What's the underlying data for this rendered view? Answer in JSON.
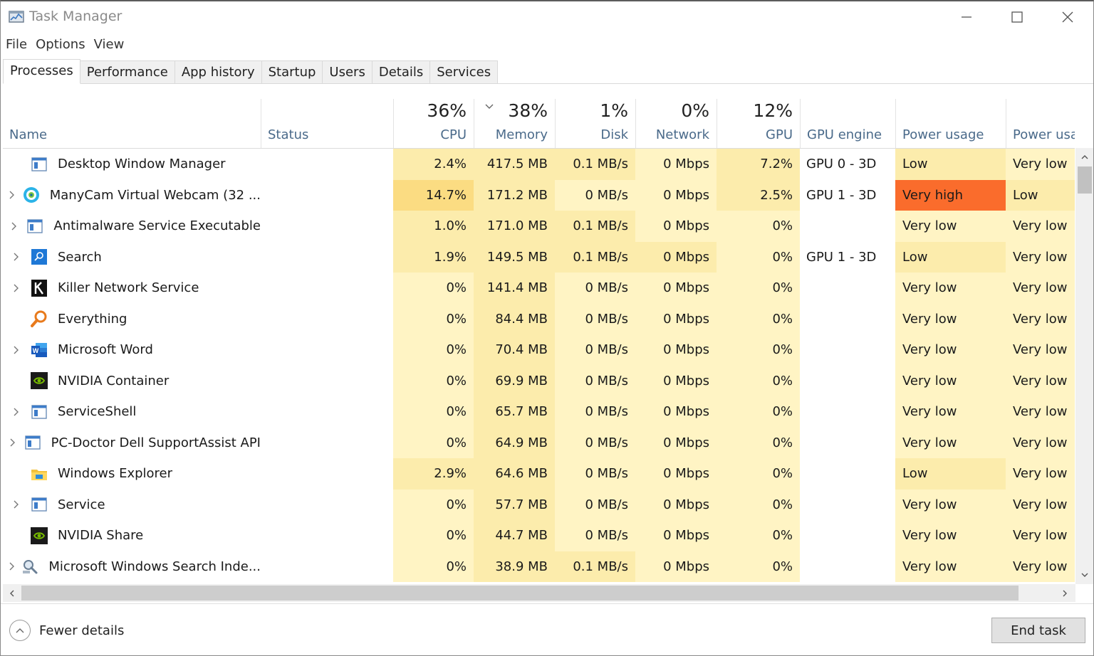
{
  "window": {
    "title": "Task Manager"
  },
  "menu": [
    "File",
    "Options",
    "View"
  ],
  "tabs": [
    {
      "label": "Processes",
      "active": true
    },
    {
      "label": "Performance",
      "active": false
    },
    {
      "label": "App history",
      "active": false
    },
    {
      "label": "Startup",
      "active": false
    },
    {
      "label": "Users",
      "active": false
    },
    {
      "label": "Details",
      "active": false
    },
    {
      "label": "Services",
      "active": false
    }
  ],
  "columns": {
    "name": {
      "label": "Name"
    },
    "status": {
      "label": "Status"
    },
    "cpu": {
      "label": "CPU",
      "pct": "36%"
    },
    "memory": {
      "label": "Memory",
      "pct": "38%"
    },
    "disk": {
      "label": "Disk",
      "pct": "1%"
    },
    "network": {
      "label": "Network",
      "pct": "0%"
    },
    "gpu": {
      "label": "GPU",
      "pct": "12%"
    },
    "gpu_engine": {
      "label": "GPU engine"
    },
    "power": {
      "label": "Power usage"
    },
    "power_trend": {
      "label": "Power usage"
    }
  },
  "colors": {
    "heat_light": "#fff4c4",
    "heat_mid": "#fcecac",
    "heat_strong": "#fbdc82",
    "very_high": "#fa6c2c",
    "header_label": "#4a6a8a"
  },
  "rows": [
    {
      "name": "Desktop Window Manager",
      "icon": "app-window-icon",
      "expand": false,
      "cpu": "2.4%",
      "mem": "417.5 MB",
      "disk": "0.1 MB/s",
      "net": "0 Mbps",
      "gpu": "7.2%",
      "engine": "GPU 0 - 3D",
      "power": "Low",
      "trend": "Very low",
      "heat": {
        "cpu": "mid",
        "mem": "mid",
        "disk": "mid",
        "net": "light",
        "gpu": "mid",
        "power": "mid",
        "trend": "light"
      }
    },
    {
      "name": "ManyCam Virtual Webcam (32 ...",
      "icon": "manycam-icon",
      "expand": true,
      "cpu": "14.7%",
      "mem": "171.2 MB",
      "disk": "0 MB/s",
      "net": "0 Mbps",
      "gpu": "2.5%",
      "engine": "GPU 1 - 3D",
      "power": "Very high",
      "trend": "Low",
      "heat": {
        "cpu": "strong",
        "mem": "mid",
        "disk": "light",
        "net": "light",
        "gpu": "mid",
        "power": "veryhigh",
        "trend": "mid"
      }
    },
    {
      "name": "Antimalware Service Executable",
      "icon": "app-window-icon",
      "expand": true,
      "cpu": "1.0%",
      "mem": "171.0 MB",
      "disk": "0.1 MB/s",
      "net": "0 Mbps",
      "gpu": "0%",
      "engine": "",
      "power": "Very low",
      "trend": "Very low",
      "heat": {
        "cpu": "mid",
        "mem": "mid",
        "disk": "mid",
        "net": "light",
        "gpu": "light",
        "power": "light",
        "trend": "light"
      }
    },
    {
      "name": "Search",
      "icon": "search-app-icon",
      "expand": true,
      "cpu": "1.9%",
      "mem": "149.5 MB",
      "disk": "0.1 MB/s",
      "net": "0 Mbps",
      "gpu": "0%",
      "engine": "GPU 1 - 3D",
      "power": "Low",
      "trend": "Very low",
      "heat": {
        "cpu": "mid",
        "mem": "mid",
        "disk": "mid",
        "net": "mid",
        "gpu": "light",
        "power": "mid",
        "trend": "light"
      }
    },
    {
      "name": "Killer Network Service",
      "icon": "killer-icon",
      "expand": true,
      "cpu": "0%",
      "mem": "141.4 MB",
      "disk": "0 MB/s",
      "net": "0 Mbps",
      "gpu": "0%",
      "engine": "",
      "power": "Very low",
      "trend": "Very low",
      "heat": {
        "cpu": "light",
        "mem": "mid",
        "disk": "light",
        "net": "light",
        "gpu": "light",
        "power": "light",
        "trend": "light"
      }
    },
    {
      "name": "Everything",
      "icon": "everything-search-icon",
      "expand": false,
      "cpu": "0%",
      "mem": "84.4 MB",
      "disk": "0 MB/s",
      "net": "0 Mbps",
      "gpu": "0%",
      "engine": "",
      "power": "Very low",
      "trend": "Very low",
      "heat": {
        "cpu": "light",
        "mem": "mid",
        "disk": "light",
        "net": "light",
        "gpu": "light",
        "power": "light",
        "trend": "light"
      }
    },
    {
      "name": "Microsoft Word",
      "icon": "word-icon",
      "expand": true,
      "cpu": "0%",
      "mem": "70.4 MB",
      "disk": "0 MB/s",
      "net": "0 Mbps",
      "gpu": "0%",
      "engine": "",
      "power": "Very low",
      "trend": "Very low",
      "heat": {
        "cpu": "light",
        "mem": "mid",
        "disk": "light",
        "net": "light",
        "gpu": "light",
        "power": "light",
        "trend": "light"
      }
    },
    {
      "name": "NVIDIA Container",
      "icon": "nvidia-icon",
      "expand": false,
      "cpu": "0%",
      "mem": "69.9 MB",
      "disk": "0 MB/s",
      "net": "0 Mbps",
      "gpu": "0%",
      "engine": "",
      "power": "Very low",
      "trend": "Very low",
      "heat": {
        "cpu": "light",
        "mem": "mid",
        "disk": "light",
        "net": "light",
        "gpu": "light",
        "power": "light",
        "trend": "light"
      }
    },
    {
      "name": "ServiceShell",
      "icon": "app-window-icon",
      "expand": true,
      "cpu": "0%",
      "mem": "65.7 MB",
      "disk": "0 MB/s",
      "net": "0 Mbps",
      "gpu": "0%",
      "engine": "",
      "power": "Very low",
      "trend": "Very low",
      "heat": {
        "cpu": "light",
        "mem": "mid",
        "disk": "light",
        "net": "light",
        "gpu": "light",
        "power": "light",
        "trend": "light"
      }
    },
    {
      "name": "PC-Doctor Dell SupportAssist API",
      "icon": "app-window-icon",
      "expand": true,
      "cpu": "0%",
      "mem": "64.9 MB",
      "disk": "0 MB/s",
      "net": "0 Mbps",
      "gpu": "0%",
      "engine": "",
      "power": "Very low",
      "trend": "Very low",
      "heat": {
        "cpu": "light",
        "mem": "mid",
        "disk": "light",
        "net": "light",
        "gpu": "light",
        "power": "light",
        "trend": "light"
      }
    },
    {
      "name": "Windows Explorer",
      "icon": "folder-icon",
      "expand": false,
      "cpu": "2.9%",
      "mem": "64.6 MB",
      "disk": "0 MB/s",
      "net": "0 Mbps",
      "gpu": "0%",
      "engine": "",
      "power": "Low",
      "trend": "Very low",
      "heat": {
        "cpu": "mid",
        "mem": "mid",
        "disk": "light",
        "net": "light",
        "gpu": "light",
        "power": "mid",
        "trend": "light"
      }
    },
    {
      "name": "Service",
      "icon": "app-window-icon",
      "expand": true,
      "cpu": "0%",
      "mem": "57.7 MB",
      "disk": "0 MB/s",
      "net": "0 Mbps",
      "gpu": "0%",
      "engine": "",
      "power": "Very low",
      "trend": "Very low",
      "heat": {
        "cpu": "light",
        "mem": "mid",
        "disk": "light",
        "net": "light",
        "gpu": "light",
        "power": "light",
        "trend": "light"
      }
    },
    {
      "name": "NVIDIA Share",
      "icon": "nvidia-icon",
      "expand": false,
      "cpu": "0%",
      "mem": "44.7 MB",
      "disk": "0 MB/s",
      "net": "0 Mbps",
      "gpu": "0%",
      "engine": "",
      "power": "Very low",
      "trend": "Very low",
      "heat": {
        "cpu": "light",
        "mem": "mid",
        "disk": "light",
        "net": "light",
        "gpu": "light",
        "power": "light",
        "trend": "light"
      }
    },
    {
      "name": "Microsoft Windows Search Inde...",
      "icon": "indexer-icon",
      "expand": true,
      "cpu": "0%",
      "mem": "38.9 MB",
      "disk": "0.1 MB/s",
      "net": "0 Mbps",
      "gpu": "0%",
      "engine": "",
      "power": "Very low",
      "trend": "Very low",
      "heat": {
        "cpu": "light",
        "mem": "mid",
        "disk": "mid",
        "net": "light",
        "gpu": "light",
        "power": "light",
        "trend": "light"
      }
    }
  ],
  "footer": {
    "fewer_details": "Fewer details",
    "end_task": "End task"
  }
}
